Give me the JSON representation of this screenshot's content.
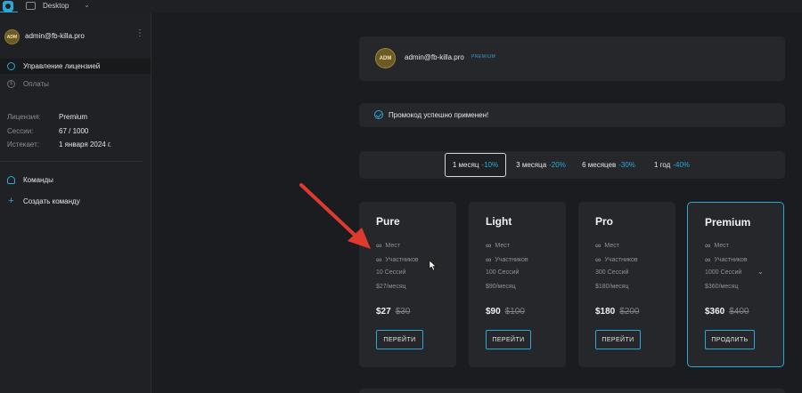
{
  "topbar": {
    "workspace": "Desktop"
  },
  "sidebar": {
    "avatar": "ADM",
    "email": "admin@fb-killa.pro",
    "nav": [
      {
        "label": "Управление лицензией"
      },
      {
        "label": "Оплаты"
      }
    ],
    "info": {
      "license_label": "Лицензия:",
      "license_value": "Premium",
      "sessions_label": "Сессии:",
      "sessions_value": "67 / 1000",
      "expires_label": "Истекает:",
      "expires_value": "1 января 2024 г."
    },
    "teams_label": "Команды",
    "create_team_label": "Создать команду"
  },
  "profile": {
    "avatar": "ADM",
    "email": "admin@fb-killa.pro",
    "badge": "PREMIUM"
  },
  "promo": {
    "message": "Промокод успешно применен!"
  },
  "periods": [
    {
      "label": "1 месяц",
      "discount": "-10%",
      "active": true
    },
    {
      "label": "3 месяца",
      "discount": "-20%"
    },
    {
      "label": "6 месяцев",
      "discount": "-30%"
    },
    {
      "label": "1 год",
      "discount": "-40%"
    }
  ],
  "plans": [
    {
      "name": "Pure",
      "seats": "Мест",
      "members": "Участников",
      "sessions": "10 Сессий",
      "monthly": "$27/месяц",
      "price": "$27",
      "old_price": "$30",
      "button": "ПЕРЕЙТИ"
    },
    {
      "name": "Light",
      "seats": "Мест",
      "members": "Участников",
      "sessions": "100 Сессий",
      "monthly": "$90/месяц",
      "price": "$90",
      "old_price": "$100",
      "button": "ПЕРЕЙТИ"
    },
    {
      "name": "Pro",
      "seats": "Мест",
      "members": "Участников",
      "sessions": "300 Сессий",
      "monthly": "$180/месяц",
      "price": "$180",
      "old_price": "$200",
      "button": "ПЕРЕЙТИ"
    },
    {
      "name": "Premium",
      "seats": "Мест",
      "members": "Участников",
      "sessions": "1000 Сессий",
      "monthly": "$360/месяц",
      "price": "$360",
      "old_price": "$400",
      "button": "ПРОДЛИТЬ"
    }
  ],
  "colors": {
    "accent": "#2aa8d8",
    "annotation_arrow": "#e03a2f"
  }
}
